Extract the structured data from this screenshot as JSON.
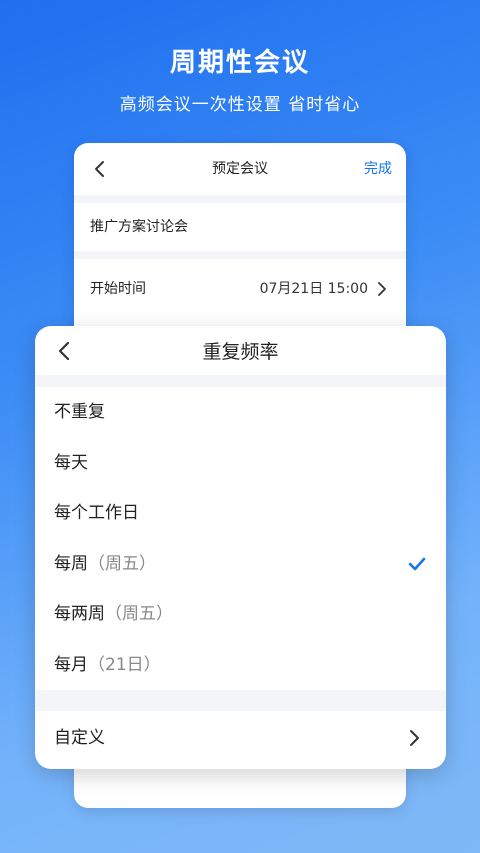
{
  "hero": {
    "title": "周期性会议",
    "subtitle": "高频会议一次性设置 省时省心"
  },
  "schedule_screen": {
    "title": "预定会议",
    "done_label": "完成",
    "meeting_name": "推广方案讨论会",
    "start_time_label": "开始时间",
    "start_time_value": "07月21日 15:00"
  },
  "repeat_sheet": {
    "title": "重复频率",
    "options": [
      {
        "label": "不重复",
        "note": ""
      },
      {
        "label": "每天",
        "note": ""
      },
      {
        "label": "每个工作日",
        "note": ""
      },
      {
        "label": "每周",
        "note": "（周五）"
      },
      {
        "label": "每两周",
        "note": "（周五）"
      },
      {
        "label": "每月",
        "note": "（21日）"
      }
    ],
    "selected_index": 3,
    "custom_label": "自定义"
  },
  "colors": {
    "accent": "#1677e8",
    "check": "#1a73e8"
  }
}
